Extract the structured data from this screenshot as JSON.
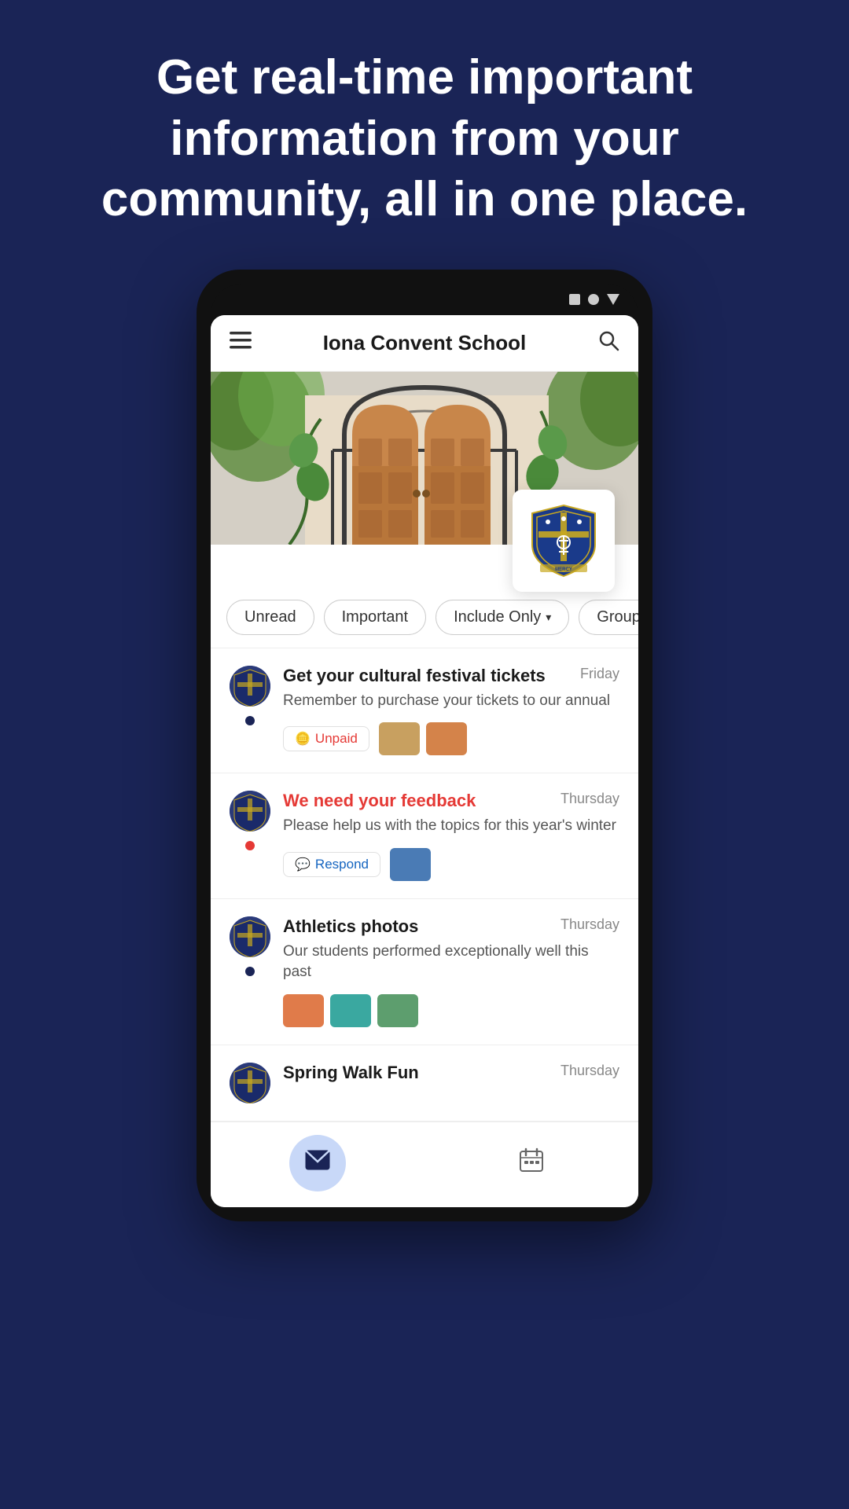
{
  "hero": {
    "text": "Get real-time important information from your community, all in one place."
  },
  "status_bar": {
    "icons": [
      "square",
      "circle",
      "triangle"
    ]
  },
  "header": {
    "menu_icon": "☰",
    "title": "Iona Convent School",
    "search_icon": "🔍"
  },
  "filters": [
    {
      "id": "unread",
      "label": "Unread",
      "has_chevron": false
    },
    {
      "id": "important",
      "label": "Important",
      "has_chevron": false
    },
    {
      "id": "include-only",
      "label": "Include Only",
      "has_chevron": true
    },
    {
      "id": "groups",
      "label": "Groups",
      "has_chevron": false
    }
  ],
  "feed_items": [
    {
      "id": "item1",
      "title": "Get your cultural festival tickets",
      "title_color": "normal",
      "date": "Friday",
      "preview": "Remember to purchase your tickets to our annual",
      "has_unread": true,
      "unread_color": "dark",
      "tag": {
        "type": "unpaid",
        "label": "Unpaid",
        "color": "red"
      },
      "thumbnails": [
        "warm1",
        "warm2"
      ]
    },
    {
      "id": "item2",
      "title": "We need your feedback",
      "title_color": "red",
      "date": "Thursday",
      "preview": "Please help us with the topics for this year's winter",
      "has_unread": true,
      "unread_color": "red",
      "tag": {
        "type": "respond",
        "label": "Respond",
        "color": "blue"
      },
      "thumbnails": [
        "blue1"
      ]
    },
    {
      "id": "item3",
      "title": "Athletics photos",
      "title_color": "normal",
      "date": "Thursday",
      "preview": "Our students performed exceptionally well this past",
      "has_unread": true,
      "unread_color": "dark",
      "tag": null,
      "thumbnails": [
        "sport1",
        "sport2",
        "sport3"
      ]
    },
    {
      "id": "item4",
      "title": "Spring Walk Fun",
      "title_color": "normal",
      "date": "Thursday",
      "preview": "",
      "has_unread": false,
      "unread_color": "dark",
      "tag": null,
      "thumbnails": []
    }
  ],
  "bottom_nav": [
    {
      "id": "mail",
      "icon": "✉",
      "active": true
    },
    {
      "id": "calendar",
      "icon": "📅",
      "active": false
    }
  ]
}
